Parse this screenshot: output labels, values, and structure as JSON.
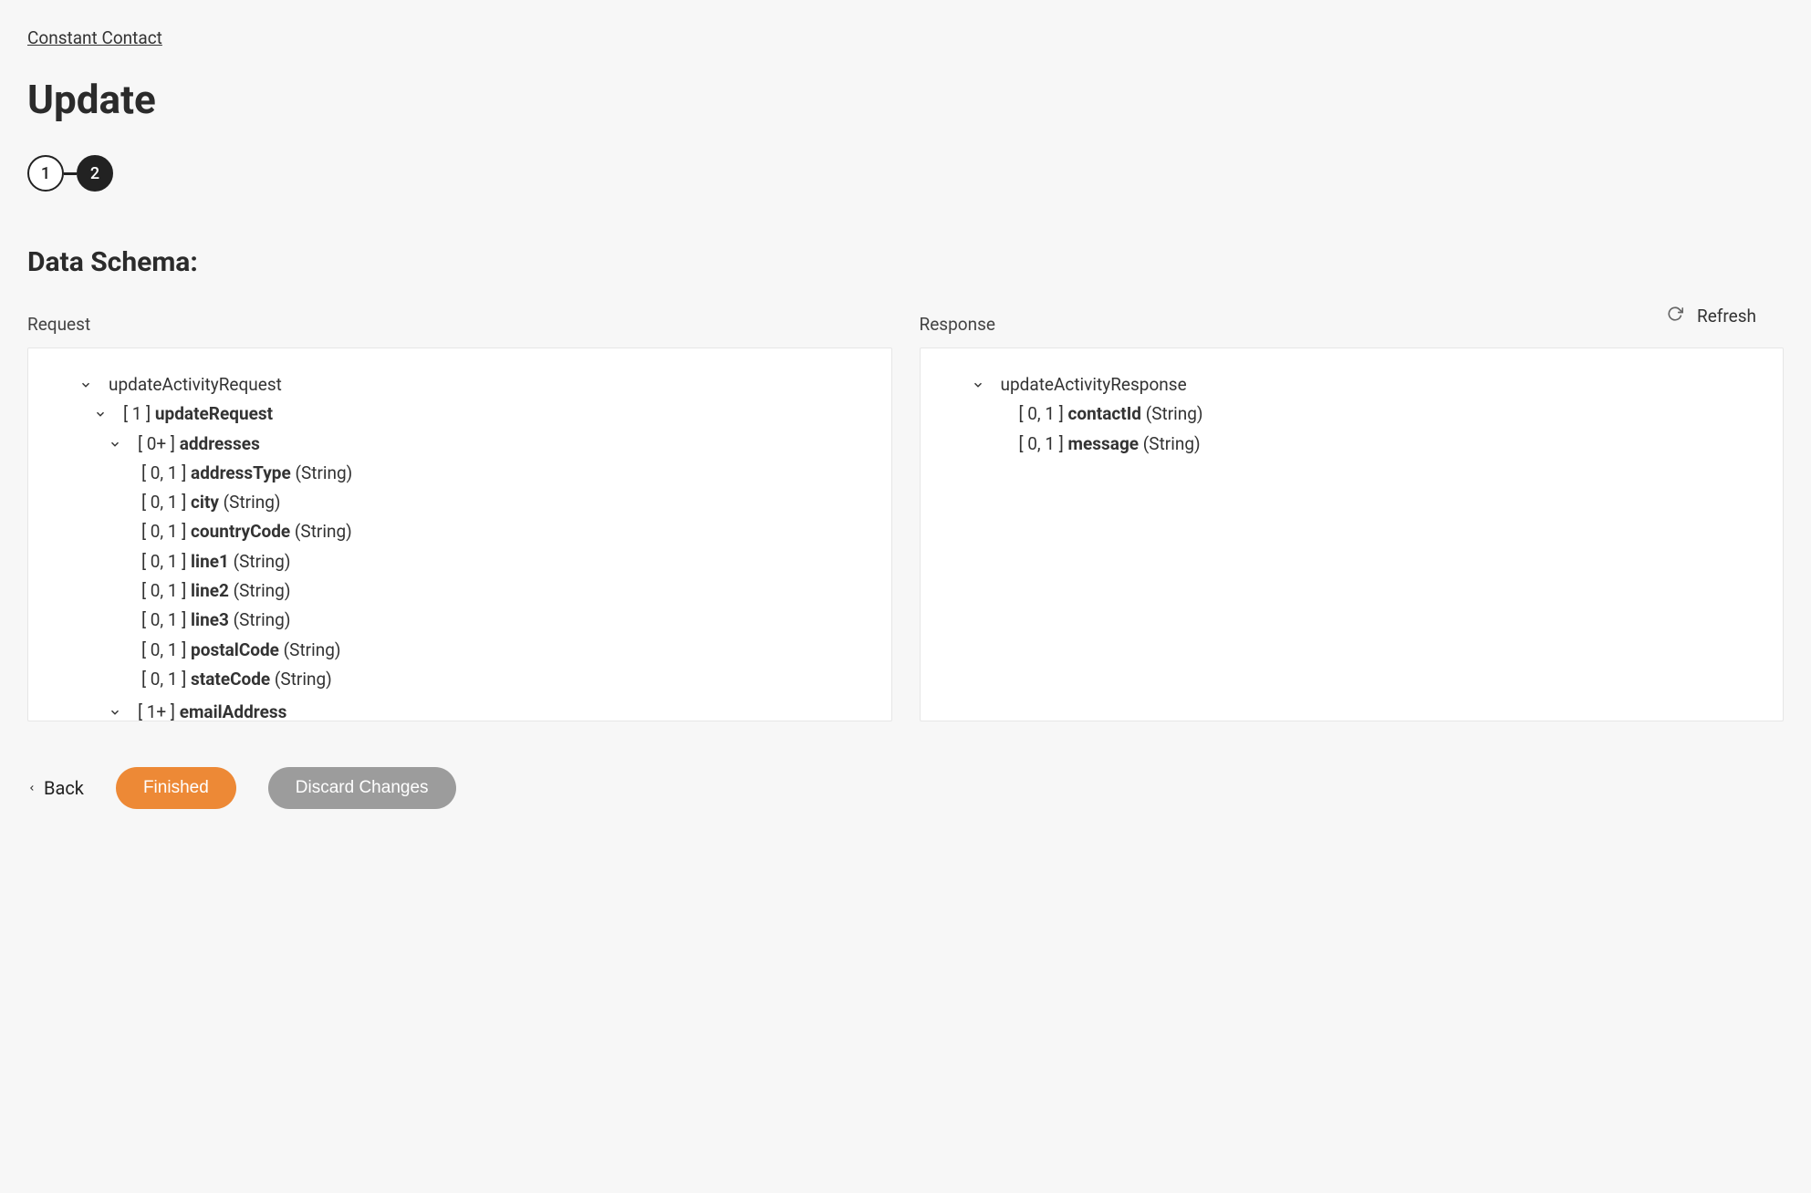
{
  "breadcrumb": "Constant Contact",
  "page_title": "Update",
  "stepper": {
    "step1": "1",
    "step2": "2"
  },
  "section_title": "Data Schema:",
  "refresh_label": "Refresh",
  "columns": {
    "request_label": "Request",
    "response_label": "Response"
  },
  "request_tree": {
    "root": "updateActivityRequest",
    "l1_card": "[ 1 ]",
    "l1_name": "updateRequest",
    "l2_card": "[ 0+ ]",
    "l2_name": "addresses",
    "fields": [
      {
        "card": "[ 0, 1 ]",
        "name": "addressType",
        "type": "(String)"
      },
      {
        "card": "[ 0, 1 ]",
        "name": "city",
        "type": "(String)"
      },
      {
        "card": "[ 0, 1 ]",
        "name": "countryCode",
        "type": "(String)"
      },
      {
        "card": "[ 0, 1 ]",
        "name": "line1",
        "type": "(String)"
      },
      {
        "card": "[ 0, 1 ]",
        "name": "line2",
        "type": "(String)"
      },
      {
        "card": "[ 0, 1 ]",
        "name": "line3",
        "type": "(String)"
      },
      {
        "card": "[ 0, 1 ]",
        "name": "postalCode",
        "type": "(String)"
      },
      {
        "card": "[ 0, 1 ]",
        "name": "stateCode",
        "type": "(String)"
      }
    ],
    "next_partial_card": "[ 1+ ]",
    "next_partial_name": "emailAddress"
  },
  "response_tree": {
    "root": "updateActivityResponse",
    "fields": [
      {
        "card": "[ 0, 1 ]",
        "name": "contactId",
        "type": "(String)"
      },
      {
        "card": "[ 0, 1 ]",
        "name": "message",
        "type": "(String)"
      }
    ]
  },
  "footer": {
    "back": "Back",
    "finished": "Finished",
    "discard": "Discard Changes"
  }
}
